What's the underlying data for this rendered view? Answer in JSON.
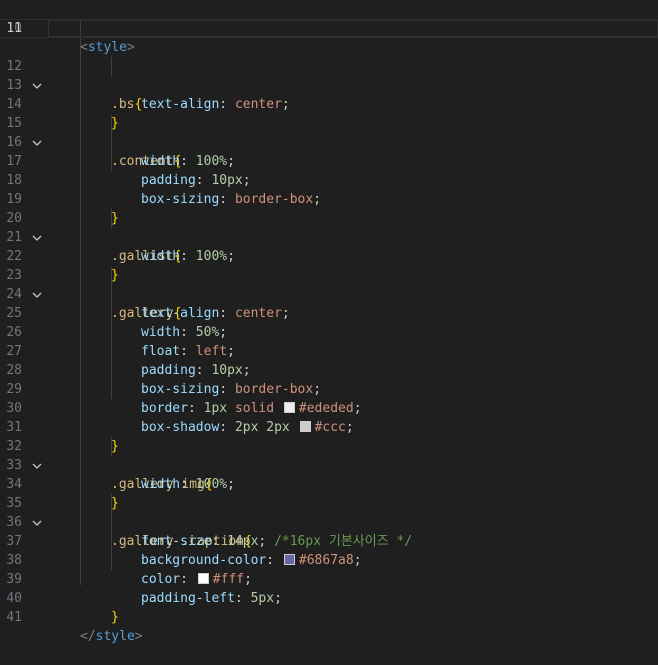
{
  "colors": {
    "swatch_ededed": "#ededed",
    "swatch_ccc": "#cccccc",
    "swatch_6867a8": "#6867a8",
    "swatch_fff": "#ffffff"
  },
  "lines": [
    {
      "n": "10",
      "t": {
        "open": "<",
        "name": "style",
        "close": ">"
      }
    },
    {
      "n": "11"
    },
    {
      "n": "12",
      "t": {
        "sel": ".bs",
        "brace": "{"
      }
    },
    {
      "n": "13",
      "t": {
        "prop": "text-align",
        "val": "center"
      }
    },
    {
      "n": "14",
      "t": {
        "brace": "}"
      }
    },
    {
      "n": "15",
      "t": {
        "sel": ".content",
        "brace": "{"
      }
    },
    {
      "n": "16",
      "t": {
        "prop": "width",
        "num": "100%"
      }
    },
    {
      "n": "17",
      "t": {
        "prop": "padding",
        "num": "10px"
      }
    },
    {
      "n": "18",
      "t": {
        "prop": "box-sizing",
        "val": "border-box"
      }
    },
    {
      "n": "19",
      "t": {
        "brace": "}"
      }
    },
    {
      "n": "20",
      "t": {
        "sel": ".gallist",
        "brace": "{"
      }
    },
    {
      "n": "21",
      "t": {
        "prop": "width",
        "num": "100%"
      }
    },
    {
      "n": "22",
      "t": {
        "brace": "}"
      }
    },
    {
      "n": "23",
      "t": {
        "sel": ".gallery",
        "brace": "{"
      }
    },
    {
      "n": "24",
      "t": {
        "prop": "text-align",
        "val": "center"
      }
    },
    {
      "n": "25",
      "t": {
        "prop": "width",
        "num": "50%"
      }
    },
    {
      "n": "26",
      "t": {
        "prop": "float",
        "val": "left"
      }
    },
    {
      "n": "27",
      "t": {
        "prop": "padding",
        "num": "10px"
      }
    },
    {
      "n": "28",
      "t": {
        "prop": "box-sizing",
        "val": "border-box"
      }
    },
    {
      "n": "29",
      "t": {
        "prop": "border",
        "num": "1px",
        "val": "solid",
        "color": "#ededed"
      }
    },
    {
      "n": "30",
      "t": {
        "prop": "box-shadow",
        "num": "2px 2px",
        "color": "#ccc"
      }
    },
    {
      "n": "31",
      "t": {
        "brace": "}"
      }
    },
    {
      "n": "32",
      "t": {
        "sel": ".gallery img",
        "brace": "{"
      }
    },
    {
      "n": "33",
      "t": {
        "prop": "width",
        "num": "100%"
      }
    },
    {
      "n": "34",
      "t": {
        "brace": "}"
      }
    },
    {
      "n": "35",
      "t": {
        "sel": ".gallery .caption",
        "brace": "{"
      }
    },
    {
      "n": "36",
      "t": {
        "prop": "font-size",
        "num": "14px",
        "comment": "/*16px 기본사이즈 */"
      }
    },
    {
      "n": "37",
      "t": {
        "prop": "background-color",
        "color": "#6867a8"
      }
    },
    {
      "n": "38",
      "t": {
        "prop": "color",
        "color": "#fff"
      }
    },
    {
      "n": "39",
      "t": {
        "prop": "padding-left",
        "num": "5px"
      }
    },
    {
      "n": "40",
      "t": {
        "brace": "}"
      }
    },
    {
      "n": "41",
      "t": {
        "open": "</",
        "name": "style",
        "close": ">"
      }
    }
  ],
  "punctuation": {
    "colon": ":",
    "semicolon": ";",
    "space": " "
  }
}
